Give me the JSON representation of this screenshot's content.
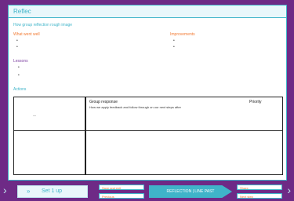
{
  "window": {
    "title": "Reflec"
  },
  "page": {
    "subtitle": "How group reflection rough image"
  },
  "sections": {
    "left": {
      "label": "What went well",
      "items": [
        "•",
        "•"
      ]
    },
    "right": {
      "label": "Improvements",
      "items": [
        "•",
        "•"
      ]
    },
    "learned": {
      "label": "Lessons",
      "items": [
        "•",
        "•"
      ]
    },
    "actions": {
      "label": "Actions"
    }
  },
  "table": {
    "col1_title": "Group response",
    "col2_title": "Priority",
    "row1_text": "How we apply feedback and follow through on our next steps after ",
    "row2_left": "—"
  },
  "footer": {
    "nav_label": "Set 1 up",
    "button_top_left": "Save and exit",
    "button_bottom_left": "Previous",
    "progress_label": "REFLECTION | LINE PAST",
    "button_top_right": "Share",
    "button_bottom_right": "Next step"
  }
}
